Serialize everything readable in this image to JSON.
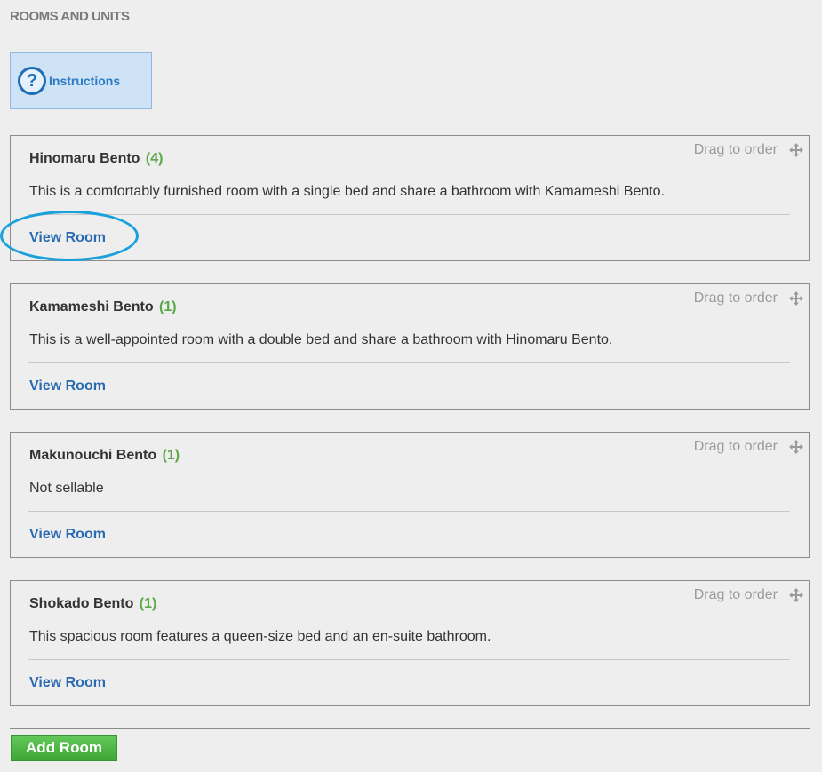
{
  "page": {
    "title": "ROOMS AND UNITS"
  },
  "instructions": {
    "label": "Instructions",
    "icon": "help-question-icon"
  },
  "rooms": [
    {
      "name": "Hinomaru Bento",
      "count": "(4)",
      "description": "This is a comfortably furnished room with a single bed and share a bathroom with Kamameshi Bento.",
      "view_label": "View Room",
      "drag_label": "Drag to order"
    },
    {
      "name": "Kamameshi Bento",
      "count": "(1)",
      "description": "This is a well-appointed room with a double bed and share a bathroom with Hinomaru Bento.",
      "view_label": "View Room",
      "drag_label": "Drag to order"
    },
    {
      "name": "Makunouchi Bento",
      "count": "(1)",
      "description": "Not sellable",
      "view_label": "View Room",
      "drag_label": "Drag to order"
    },
    {
      "name": "Shokado Bento",
      "count": "(1)",
      "description": "This spacious room features a queen-size bed and an en-suite bathroom.",
      "view_label": "View Room",
      "drag_label": "Drag to order"
    }
  ],
  "add_room": {
    "label": "Add Room"
  },
  "colors": {
    "background": "#eeeeee",
    "link": "#2a6bb0",
    "count": "#5ba84a",
    "add_button": "#4cb843",
    "highlight": "#1aa0db"
  }
}
